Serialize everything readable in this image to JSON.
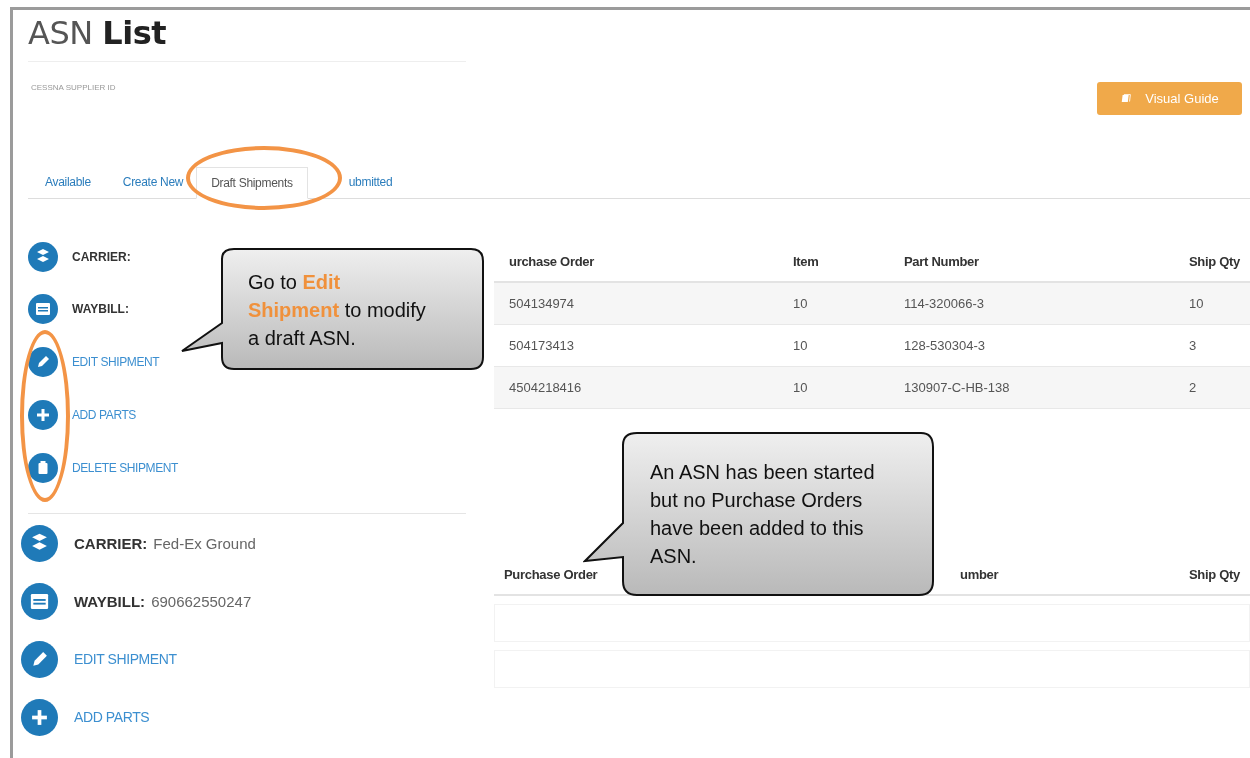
{
  "header": {
    "title_light": "ASN",
    "title_bold": "List",
    "supplier_label": "CESSNA SUPPLIER ID",
    "guide_button": "Visual Guide"
  },
  "tabs": [
    {
      "label": "Available",
      "selected": false
    },
    {
      "label": "Create New",
      "selected": false
    },
    {
      "label": "Draft Shipments",
      "selected": true
    },
    {
      "label": "ubmitted",
      "selected": false
    }
  ],
  "shipments": [
    {
      "carrier_label": "CARRIER:",
      "waybill_label": "WAYBILL:",
      "actions": [
        {
          "kind": "edit",
          "label": "EDIT SHIPMENT"
        },
        {
          "kind": "add",
          "label": "ADD PARTS"
        },
        {
          "kind": "delete",
          "label": "DELETE SHIPMENT"
        }
      ],
      "table": {
        "columns": [
          {
            "label": "urchase Order"
          },
          {
            "label": "Item"
          },
          {
            "label": "Part Number"
          },
          {
            "label": "Ship Qty"
          }
        ],
        "rows": [
          [
            "504134974",
            "10",
            "114-320066-3",
            "10"
          ],
          [
            "504173413",
            "10",
            "128-530304-3",
            "3"
          ],
          [
            "4504218416",
            "10",
            "130907-C-HB-138",
            "2"
          ]
        ]
      }
    },
    {
      "carrier_label": "CARRIER:",
      "carrier_value": "Fed-Ex Ground",
      "waybill_label": "WAYBILL:",
      "waybill_value": "690662550247",
      "actions": [
        {
          "kind": "edit",
          "label": "EDIT SHIPMENT"
        },
        {
          "kind": "add",
          "label": "ADD PARTS"
        }
      ],
      "table": {
        "columns": [
          {
            "label": "Purchase Order",
            "kind": "wide"
          },
          {
            "label": "umber",
            "kind": "partial"
          },
          {
            "label": "Ship Qty"
          }
        ]
      }
    }
  ],
  "annotations": [
    {
      "kind": "callout-left",
      "text": "Go to **Edit Shipment** to modify a draft ASN."
    },
    {
      "kind": "callout-table",
      "text": "An ASN has been started but no Purchase Orders have been added to this ASN."
    },
    {
      "kind": "ring-tab"
    },
    {
      "kind": "ring-actions"
    }
  ]
}
